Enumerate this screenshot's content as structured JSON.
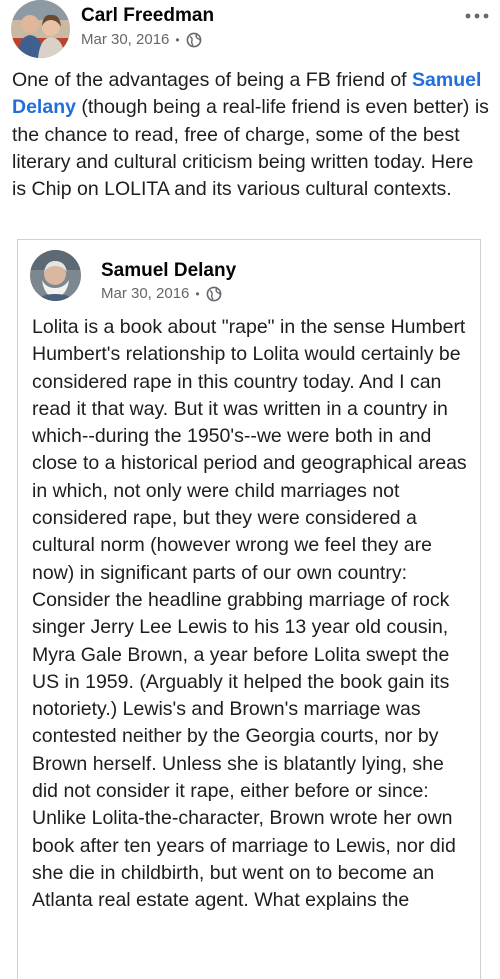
{
  "post": {
    "author": "Carl Freedman",
    "date": "Mar 30, 2016",
    "privacy_icon": "globe-icon",
    "more_icon": "more-horizontal-icon",
    "text_before": "One of the advantages of being a FB friend of ",
    "mention": "Samuel Delany",
    "text_after": " (though being a real-life friend is even better) is the chance to read, free of charge, some of the best literary and cultural criticism being written today.  Here is Chip on LOLITA and its various cultural contexts."
  },
  "shared": {
    "author": "Samuel Delany",
    "date": "Mar 30, 2016",
    "privacy_icon": "globe-icon",
    "text": "Lolita is a book about \"rape\" in the sense Humbert Humbert's relationship to Lolita would certainly be considered rape in this country today. And I can read it that way. But it was written in a country in which--during the 1950's--we were both in and close to a historical period and geographical areas in which, not only were child marriages not considered rape, but they were considered a cultural norm (however wrong we feel they are now) in significant parts of our own country: Consider the headline grabbing marriage of rock singer Jerry Lee Lewis to his 13 year old cousin, Myra Gale Brown, a year before Lolita swept the US in 1959. (Arguably it helped the book gain its notoriety.) Lewis's and Brown's marriage was contested neither by the Georgia courts, nor by Brown herself. Unless she is blatantly lying, she did not consider it rape, either before or since: Unlike Lolita-the-character, Brown wrote her own book after ten years of marriage to Lewis, nor did she die in childbirth, but went on to become an Atlanta real estate agent. What explains the"
  },
  "colors": {
    "link": "#216fdb",
    "meta": "#65676b",
    "text": "#1c1e21",
    "border": "#ced0d4"
  }
}
